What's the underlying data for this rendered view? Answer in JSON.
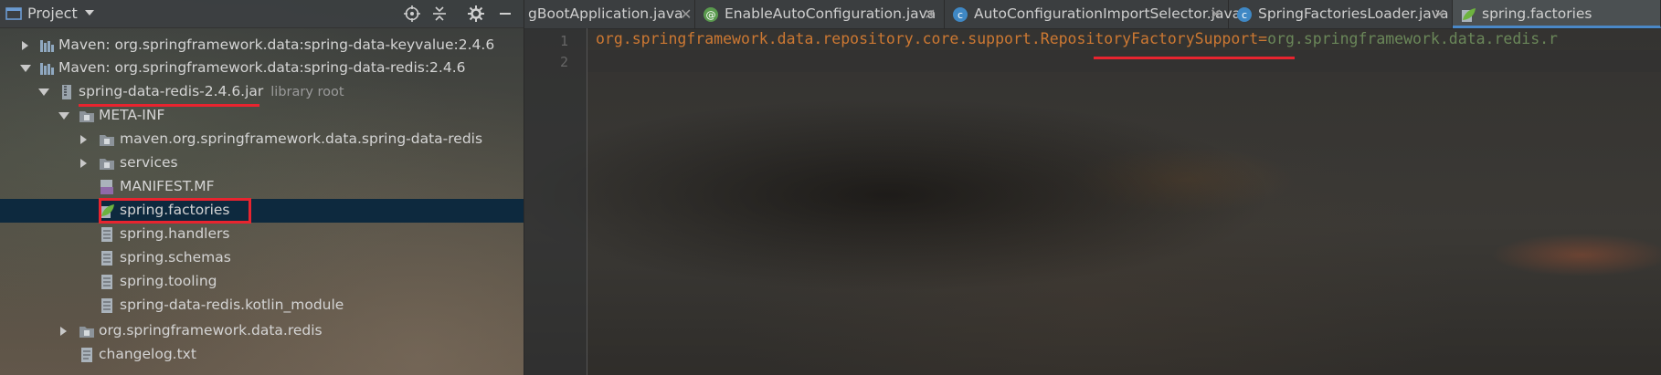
{
  "project_panel": {
    "title": "Project",
    "tree": [
      {
        "id": "maven-keyvalue",
        "label": "Maven: org.springframework.data:spring-data-keyvalue:2.4.6",
        "sub": ""
      },
      {
        "id": "maven-redis",
        "label": "Maven: org.springframework.data:spring-data-redis:2.4.6",
        "sub": ""
      },
      {
        "id": "jar",
        "label": "spring-data-redis-2.4.6.jar",
        "sub": "library root"
      },
      {
        "id": "meta-inf",
        "label": "META-INF",
        "sub": ""
      },
      {
        "id": "maven-pkg",
        "label": "maven.org.springframework.data.spring-data-redis",
        "sub": ""
      },
      {
        "id": "services",
        "label": "services",
        "sub": ""
      },
      {
        "id": "manifest",
        "label": "MANIFEST.MF",
        "sub": ""
      },
      {
        "id": "spring-factories",
        "label": "spring.factories",
        "sub": ""
      },
      {
        "id": "spring-handlers",
        "label": "spring.handlers",
        "sub": ""
      },
      {
        "id": "spring-schemas",
        "label": "spring.schemas",
        "sub": ""
      },
      {
        "id": "spring-tooling",
        "label": "spring.tooling",
        "sub": ""
      },
      {
        "id": "kotlin-module",
        "label": "spring-data-redis.kotlin_module",
        "sub": ""
      },
      {
        "id": "redis-pkg",
        "label": "org.springframework.data.redis",
        "sub": ""
      },
      {
        "id": "changelog",
        "label": "changelog.txt",
        "sub": ""
      }
    ]
  },
  "editor": {
    "tabs": [
      {
        "label": "gBootApplication.java",
        "active": false
      },
      {
        "label": "EnableAutoConfiguration.java",
        "active": false
      },
      {
        "label": "AutoConfigurationImportSelector.java",
        "active": false
      },
      {
        "label": "SpringFactoriesLoader.java",
        "active": false
      },
      {
        "label": "spring.factories",
        "active": true
      }
    ],
    "line_numbers": [
      "1",
      "2"
    ],
    "code": {
      "key": "org.springframework.data.repository.core.support.RepositoryFactorySupport",
      "eq": "=",
      "value": "org.springframework.data.redis.r"
    }
  },
  "colors": {
    "highlight_red": "#e8242f",
    "selection_blue": "#0d293e",
    "key_orange": "#cc7832",
    "value_green": "#6a8759"
  }
}
